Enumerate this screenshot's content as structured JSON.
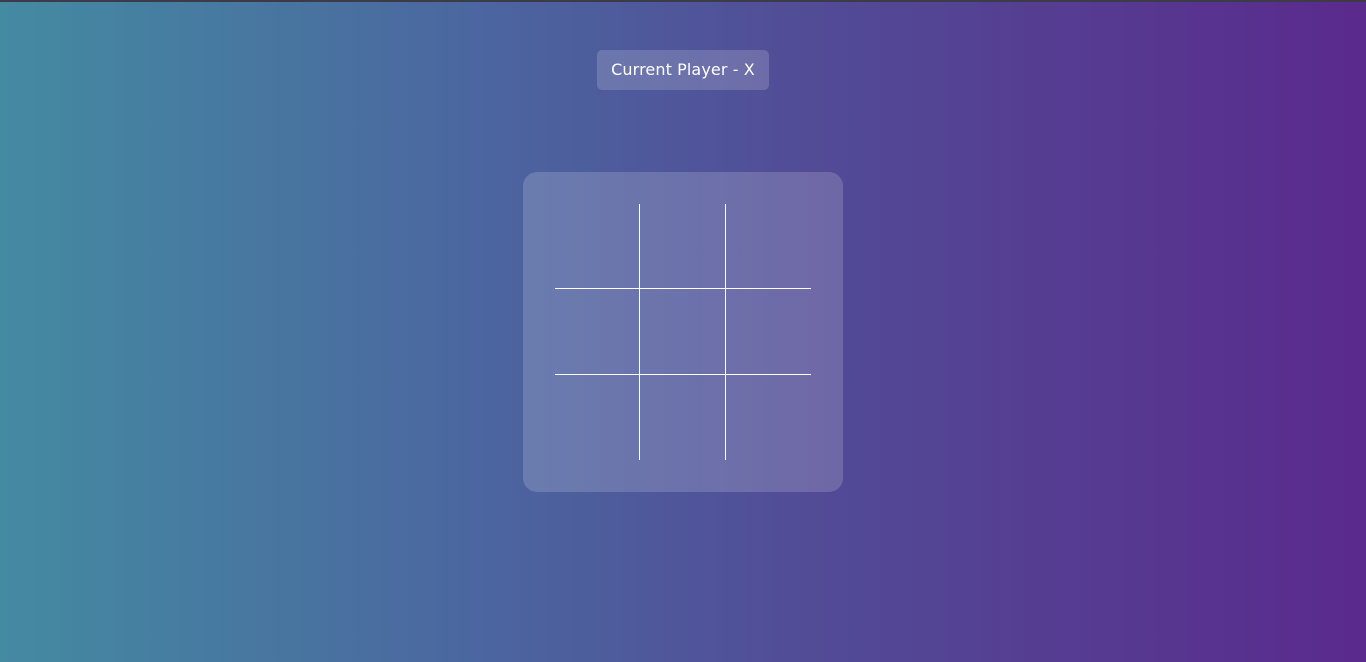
{
  "status": {
    "current_player_text": "Current Player - X"
  },
  "board": {
    "cells": [
      "",
      "",
      "",
      "",
      "",
      "",
      "",
      "",
      ""
    ]
  },
  "colors": {
    "gradient_start": "#448aa1",
    "gradient_end": "#5a2a8d",
    "grid_line": "#ffffff"
  }
}
